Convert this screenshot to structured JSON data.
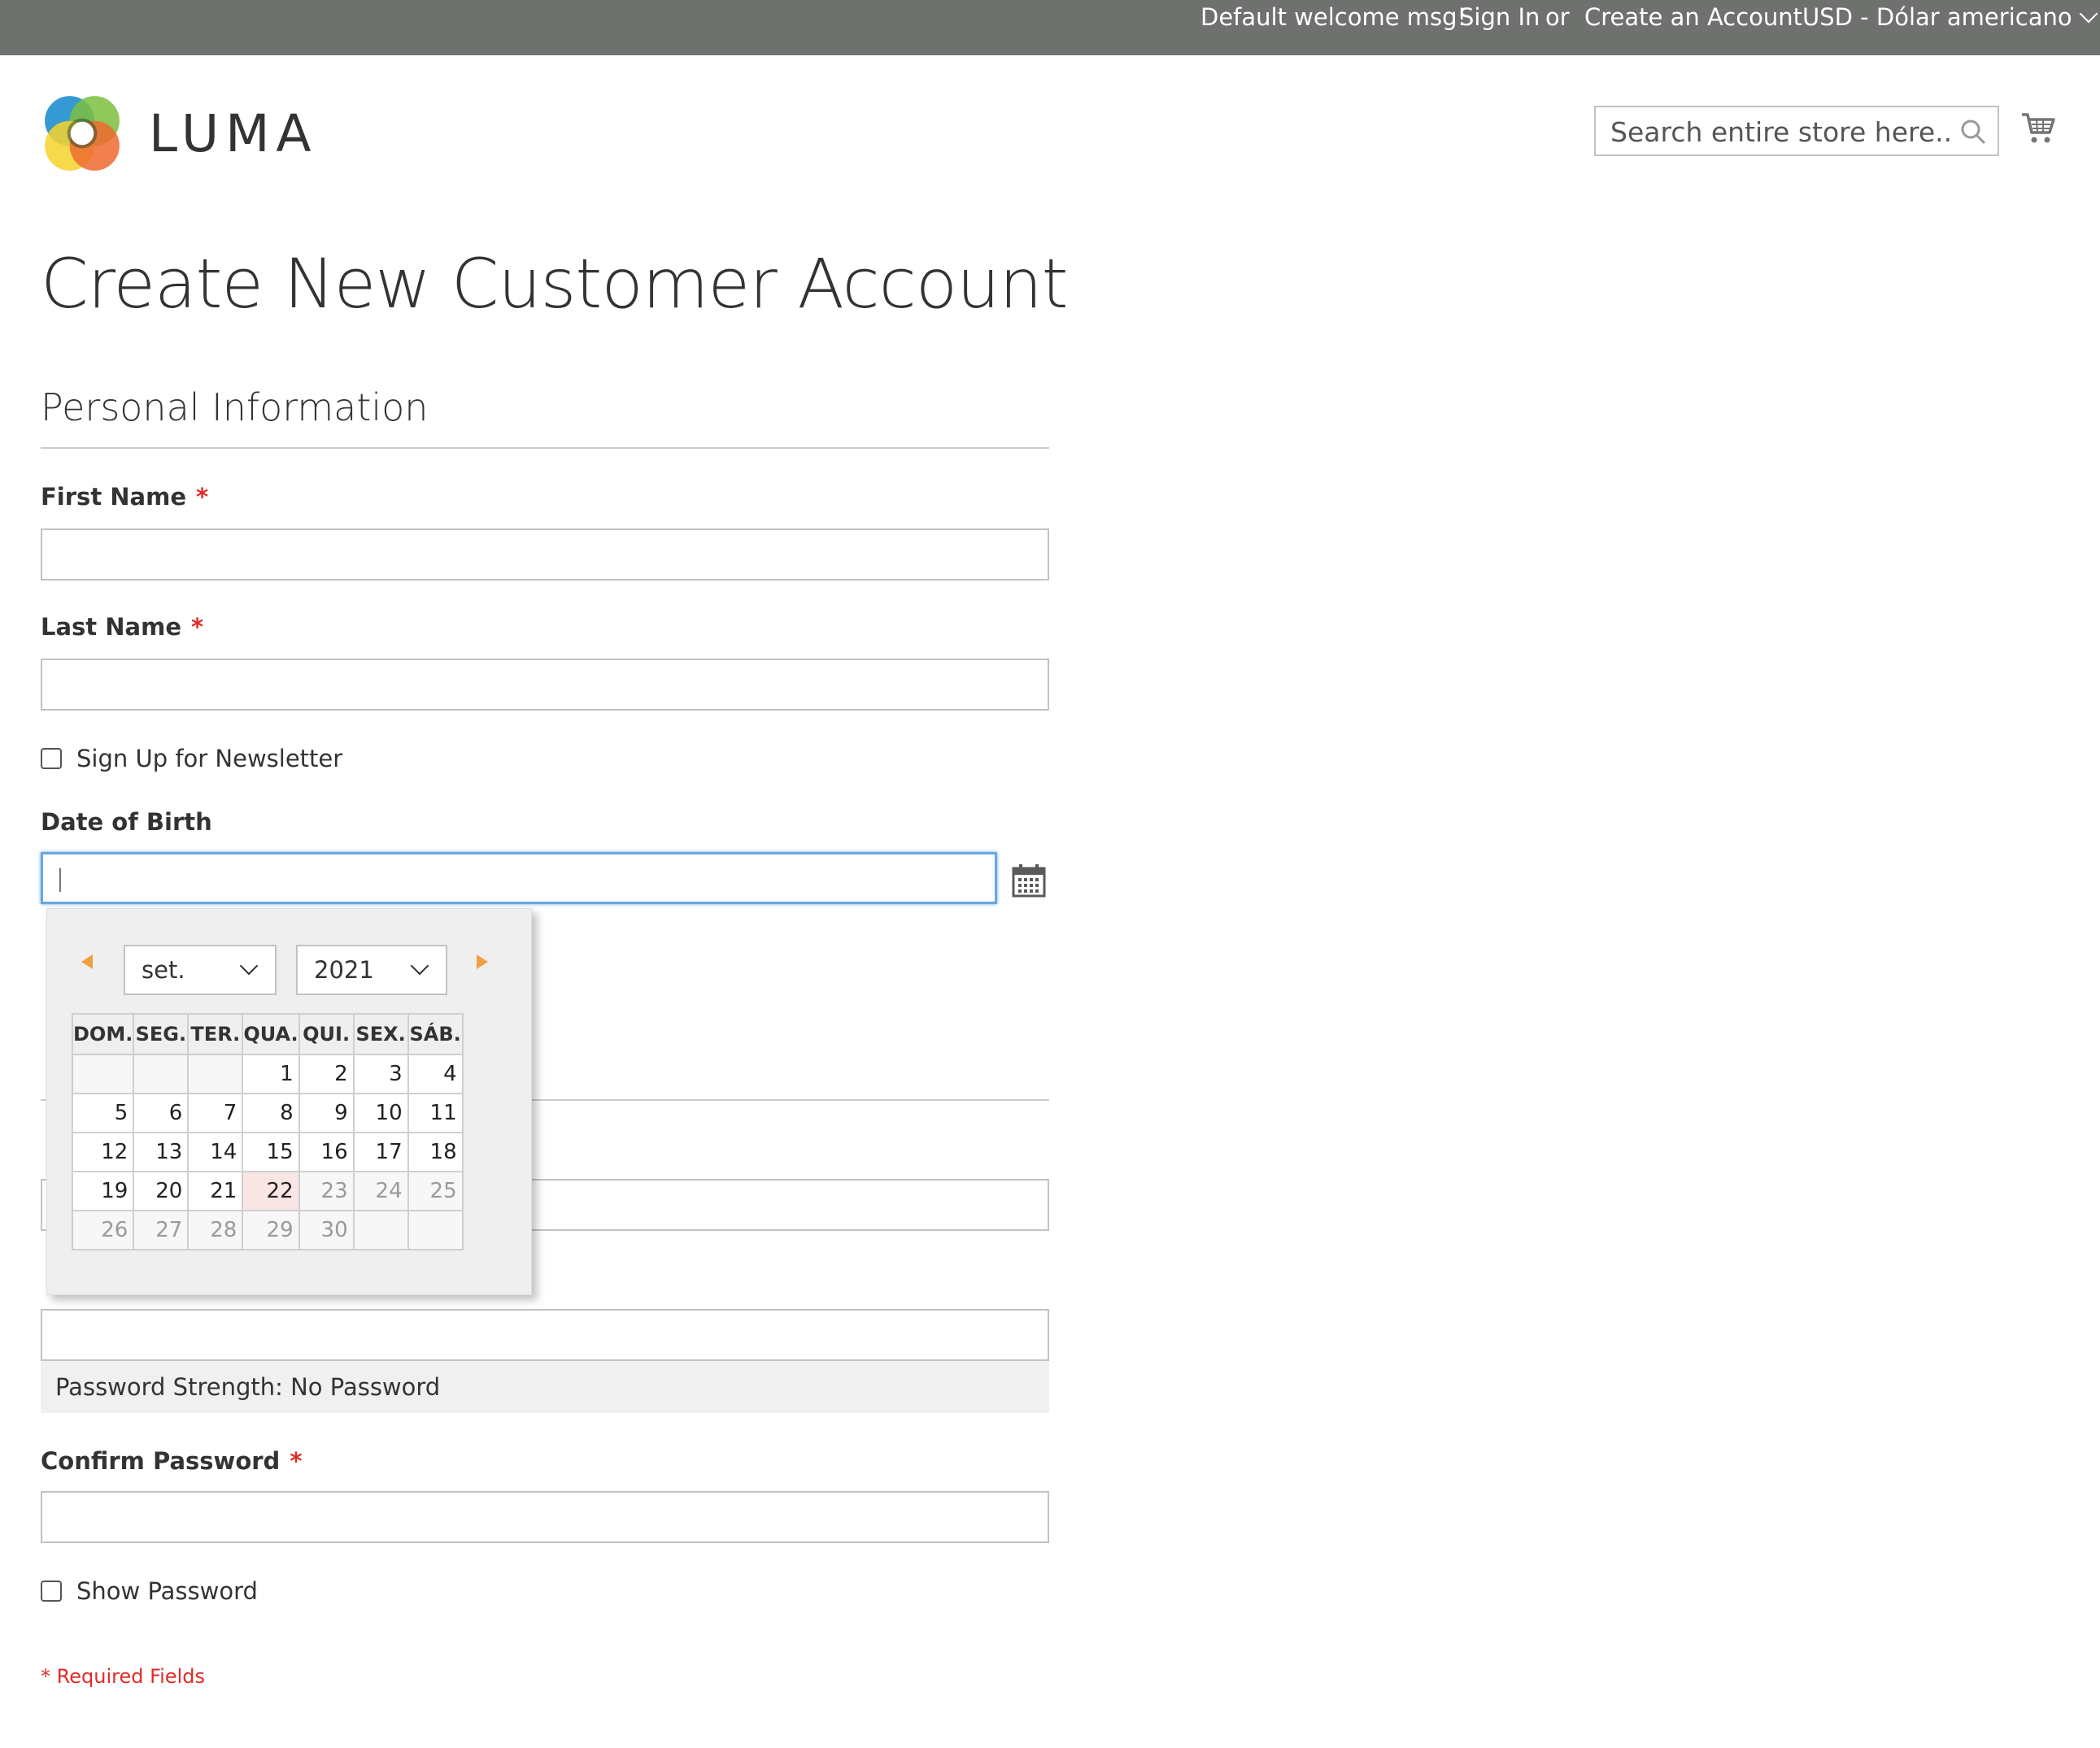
{
  "topbar": {
    "welcome": "Default welcome msg!",
    "sign_in": "Sign In",
    "or": "or",
    "create_account": "Create an Account",
    "currency": "USD - Dólar americano"
  },
  "header": {
    "logo_text": "LUMA",
    "search_placeholder": "Search entire store here..."
  },
  "page": {
    "title": "Create New Customer Account",
    "personal_section": "Personal Information"
  },
  "form": {
    "first_name_label": "First Name",
    "last_name_label": "Last Name",
    "required_mark": "*",
    "newsletter_label": "Sign Up for Newsletter",
    "dob_label": "Date of Birth",
    "dob_value": "|",
    "password_strength": "Password Strength: No Password",
    "confirm_password_label": "Confirm Password",
    "show_password_label": "Show Password",
    "required_fields_note": "* Required Fields"
  },
  "datepicker": {
    "month": "set.",
    "year": "2021",
    "weekdays": [
      "DOM.",
      "SEG.",
      "TER.",
      "QUA.",
      "QUI.",
      "SEX.",
      "SÁB."
    ],
    "weeks": [
      [
        "",
        "",
        "",
        "1",
        "2",
        "3",
        "4"
      ],
      [
        "5",
        "6",
        "7",
        "8",
        "9",
        "10",
        "11"
      ],
      [
        "12",
        "13",
        "14",
        "15",
        "16",
        "17",
        "18"
      ],
      [
        "19",
        "20",
        "21",
        "22",
        "23",
        "24",
        "25"
      ],
      [
        "26",
        "27",
        "28",
        "29",
        "30",
        "",
        ""
      ]
    ],
    "today": "22",
    "disabled_after": "22"
  },
  "colors": {
    "topbar_bg": "#6e716e",
    "required": "#e02b27",
    "focus_border": "#68a8e0",
    "nav_arrow": "#f29e43",
    "today_bg": "#fae5e5"
  }
}
